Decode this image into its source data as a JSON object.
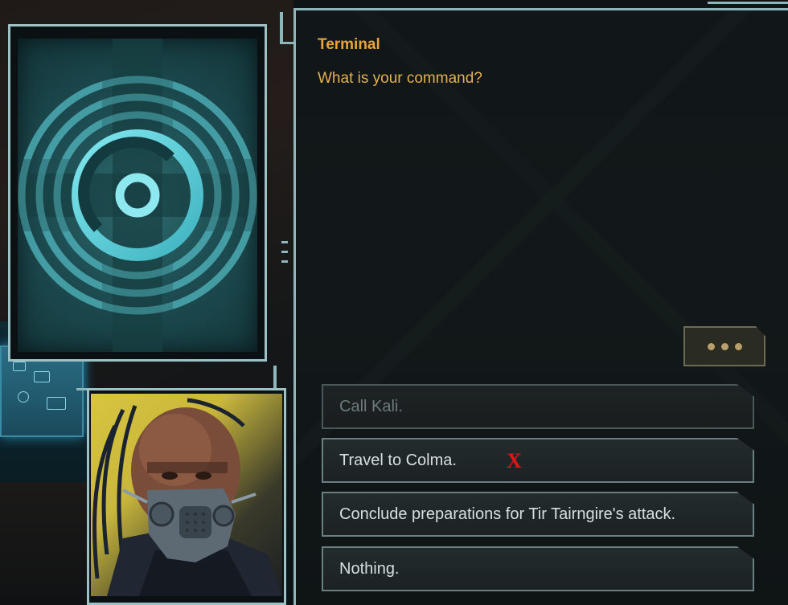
{
  "dialog": {
    "speaker": "Terminal",
    "text": "What is your command?"
  },
  "more_button": {
    "icon": "ellipsis-icon"
  },
  "options": [
    {
      "label": "Call Kali.",
      "enabled": false
    },
    {
      "label": "Travel to Colma.",
      "enabled": true,
      "annotation": "X"
    },
    {
      "label": "Conclude preparations for Tir Tairngire's attack.",
      "enabled": true
    },
    {
      "label": "Nothing.",
      "enabled": true
    }
  ],
  "colors": {
    "speaker": "#e8a33a",
    "dialog_text": "#e2b050",
    "frame": "#9cc2c6",
    "annotation_mark": "#e01616"
  },
  "images": {
    "card_icon": "terminal-signal-icon",
    "portrait": "masked-character-portrait"
  }
}
